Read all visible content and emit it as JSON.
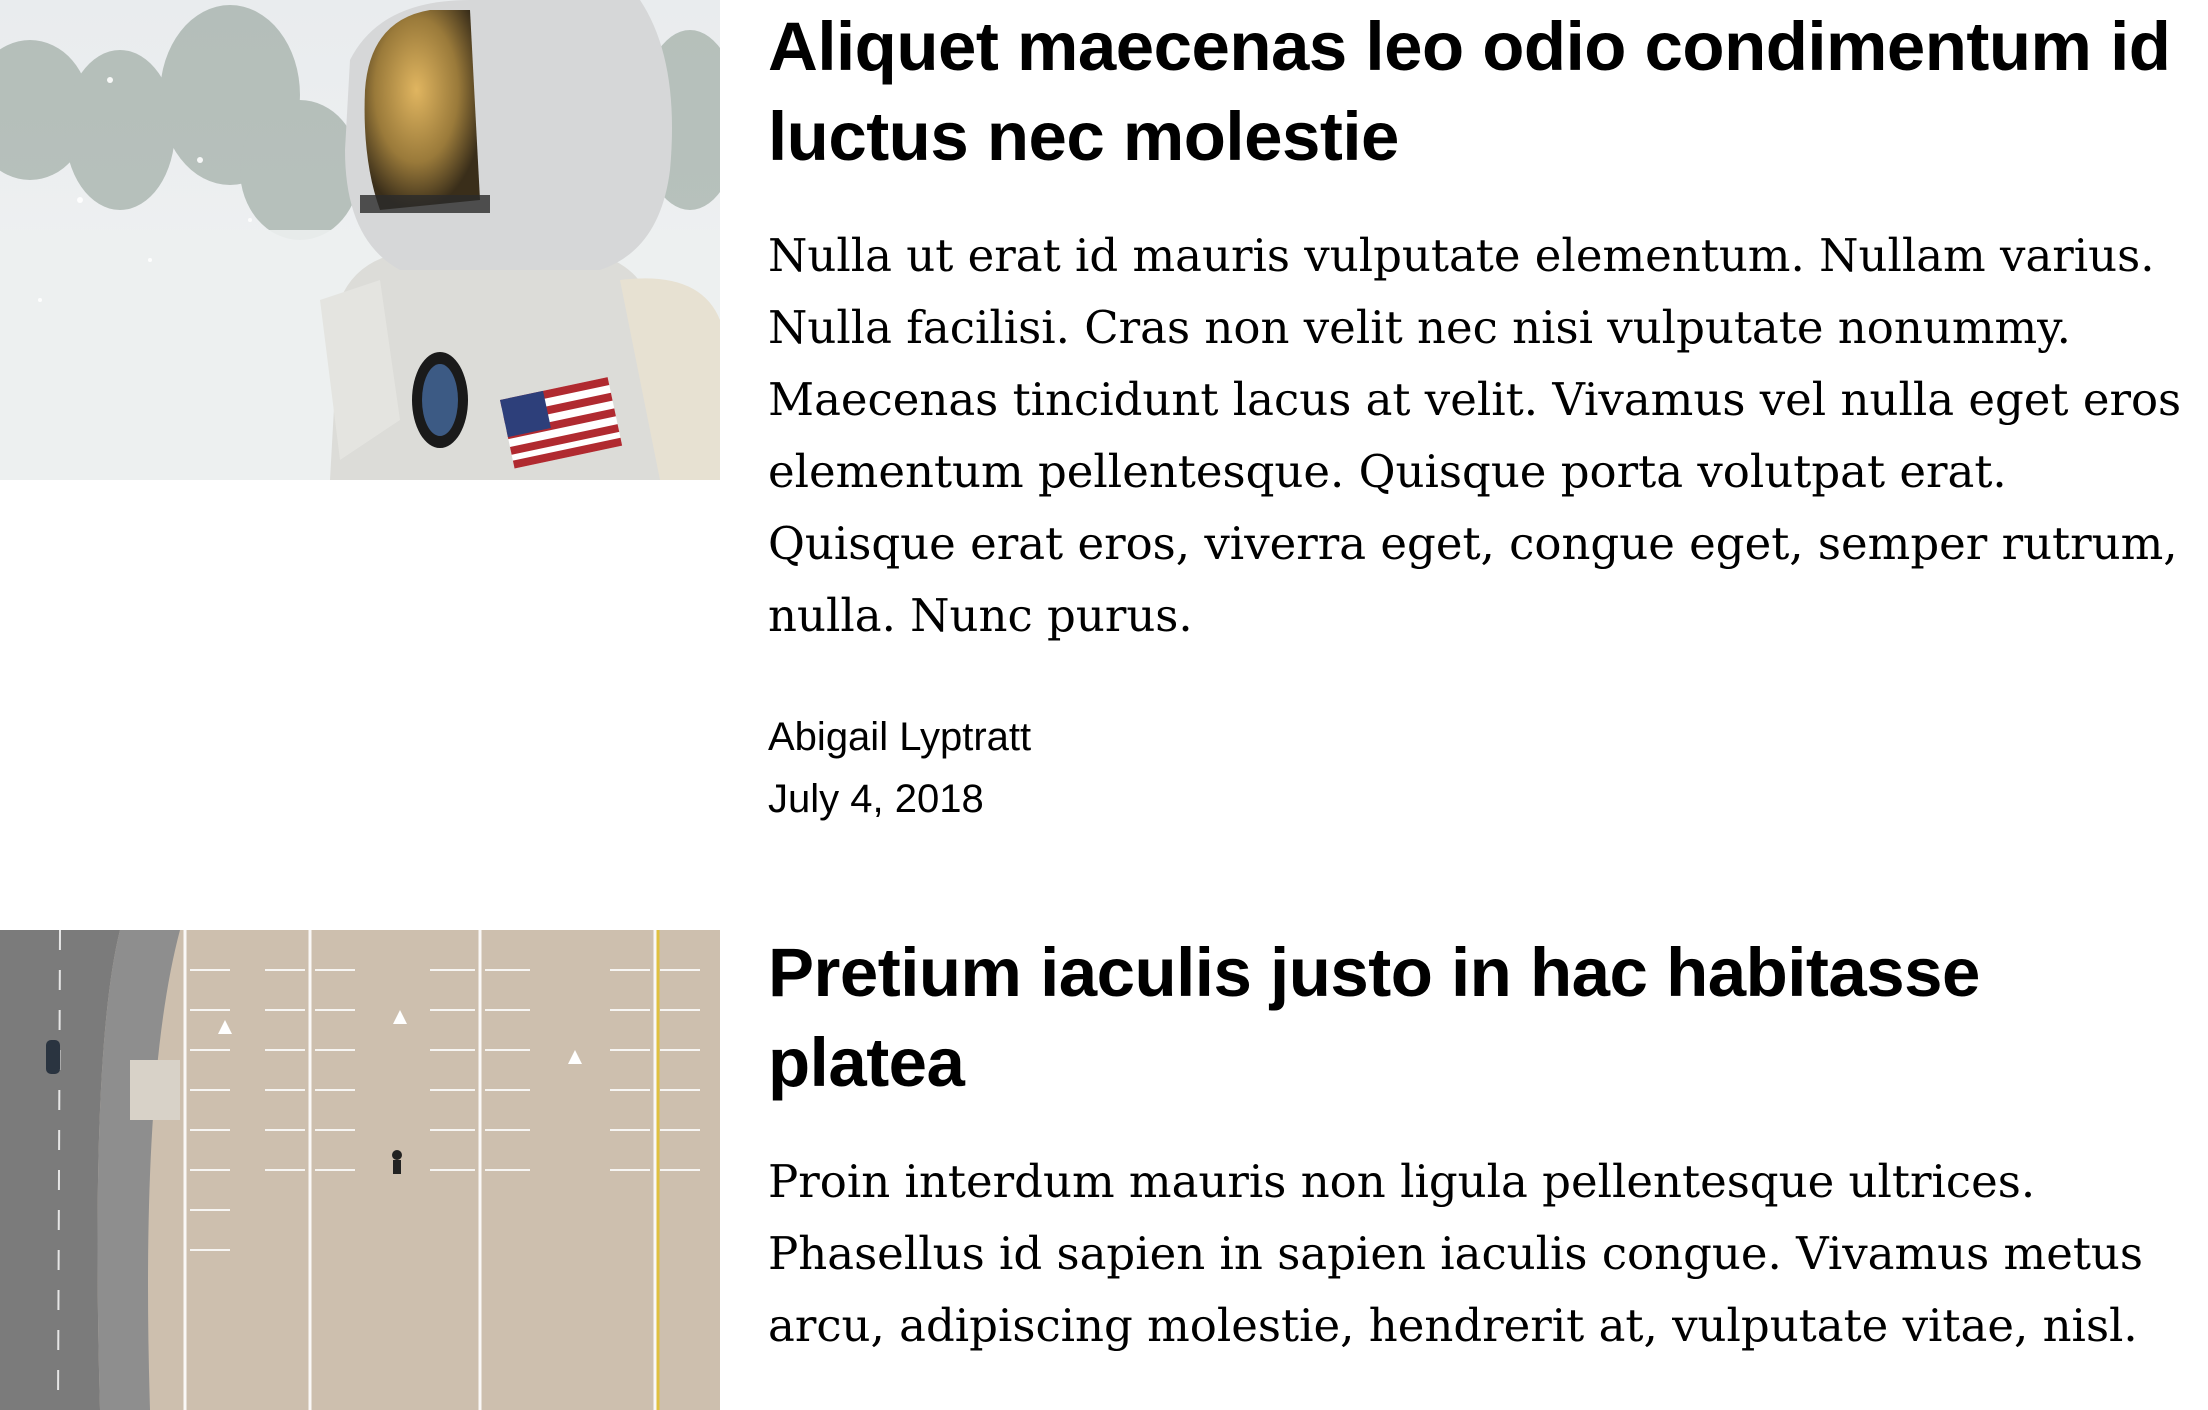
{
  "articles": [
    {
      "image": "astronaut-photo",
      "title": "Aliquet maecenas leo odio condimentum id luctus nec molestie",
      "body": "Nulla ut erat id mauris vulputate elementum. Nullam varius. Nulla facilisi. Cras non velit nec nisi vulputate nonummy. Maecenas tincidunt lacus at velit. Vivamus vel nulla eget eros elementum pellentesque. Quisque porta volutpat erat. Quisque erat eros, viverra eget, congue eget, semper rutrum, nulla. Nunc purus.",
      "author": "Abigail Lyptratt",
      "date": "July 4, 2018"
    },
    {
      "image": "parking-lot-aerial-photo",
      "title": "Pretium iaculis justo in hac habitasse platea",
      "body": "Proin interdum mauris non ligula pellentesque ultrices. Phasellus id sapien in sapien iaculis congue. Vivamus metus arcu, adipiscing molestie, hendrerit at, vulputate vitae, nisl."
    }
  ]
}
